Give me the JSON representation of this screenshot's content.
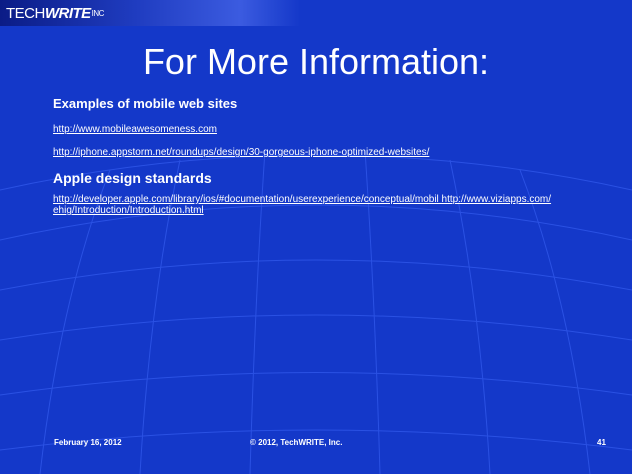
{
  "logo": {
    "part1": "TECH",
    "part2": "WRITE",
    "suffix": "INC"
  },
  "slide": {
    "title": "For More Information:",
    "section1_heading": "Examples of mobile web sites",
    "links1": [
      "http://www.mobileawesomeness.com",
      "http://iphone.appstorm.net/roundups/design/30-gorgeous-iphone-optimized-websites/"
    ],
    "section2_heading": "Apple design standards",
    "link2": "http://developer.apple.com/library/ios/#documentation/userexperience/conceptual/mobil http://www.viziapps.com/ ehig/Introduction/Introduction.html"
  },
  "footer": {
    "date": "February 16, 2012",
    "copyright": "© 2012, TechWRITE, Inc.",
    "page": "41"
  },
  "colors": {
    "background": "#1438c9",
    "text": "#ffffff"
  }
}
